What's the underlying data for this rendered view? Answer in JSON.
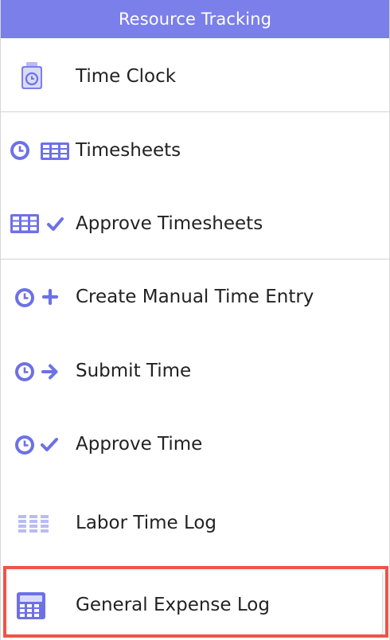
{
  "header": {
    "title": "Resource Tracking"
  },
  "accent_color": "#7b7fea",
  "highlight_color": "#f0534a",
  "items": [
    {
      "label": "Time Clock",
      "icon": "time-clock-icon"
    },
    {
      "label": "Timesheets",
      "icon": "clock-and-grid-icon"
    },
    {
      "label": "Approve Timesheets",
      "icon": "grid-check-icon"
    },
    {
      "label": "Create Manual Time Entry",
      "icon": "clock-plus-icon"
    },
    {
      "label": "Submit Time",
      "icon": "clock-arrow-icon"
    },
    {
      "label": "Approve Time",
      "icon": "clock-check-icon"
    },
    {
      "label": "Labor Time Log",
      "icon": "labor-log-icon"
    },
    {
      "label": "General Expense Log",
      "icon": "calculator-icon",
      "selected": true
    }
  ]
}
